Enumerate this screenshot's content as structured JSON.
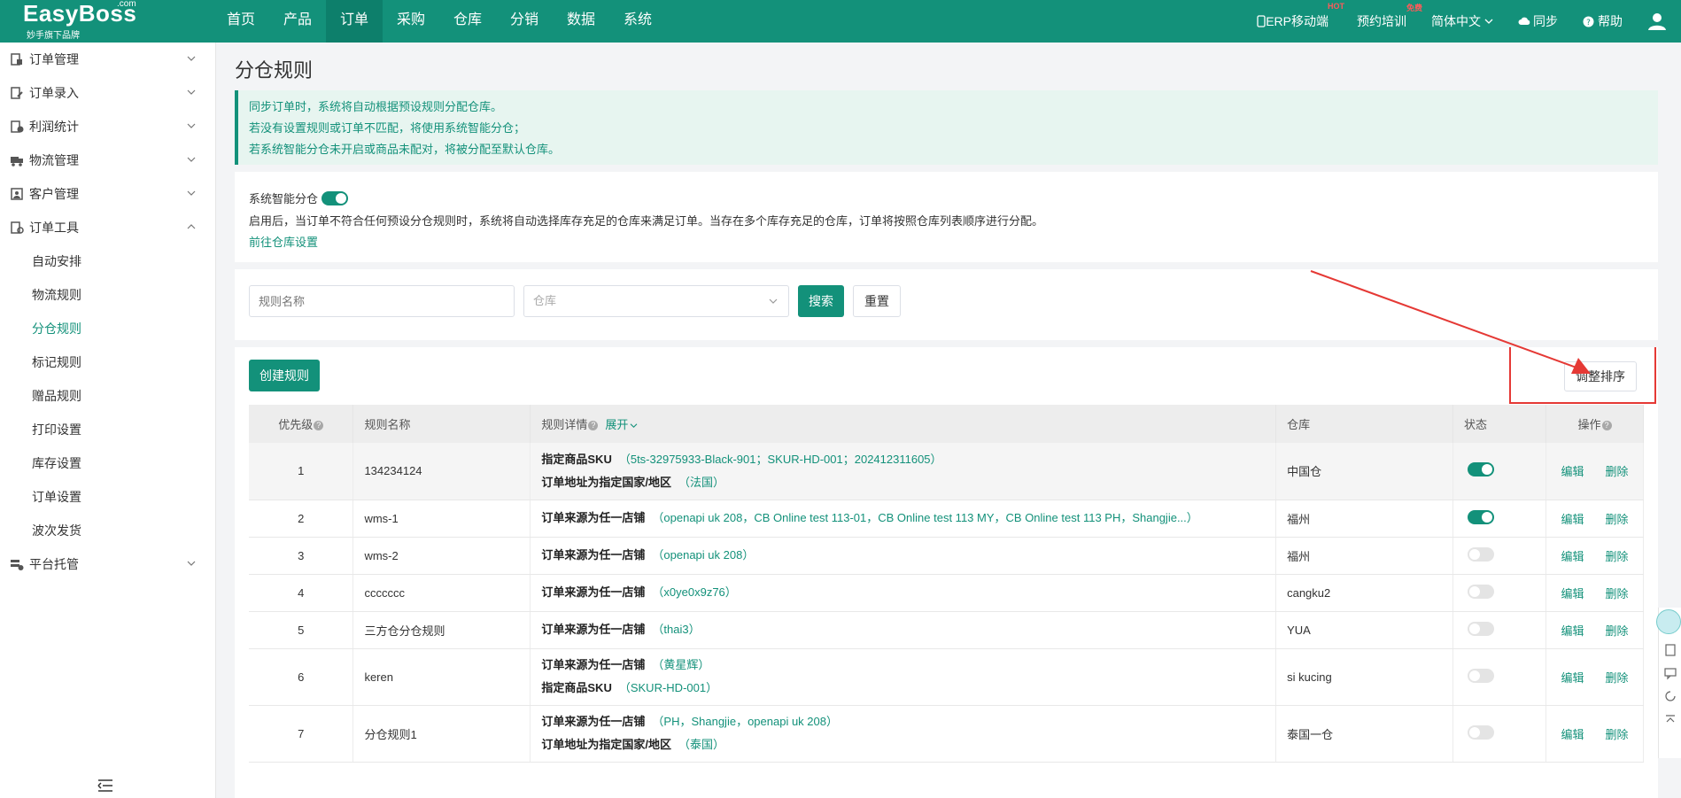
{
  "logo": {
    "name": "EasyBoss",
    "com": ".com",
    "sub": "妙手旗下品牌"
  },
  "nav": [
    {
      "label": "首页"
    },
    {
      "label": "产品"
    },
    {
      "label": "订单",
      "active": true
    },
    {
      "label": "采购"
    },
    {
      "label": "仓库"
    },
    {
      "label": "分销"
    },
    {
      "label": "数据"
    },
    {
      "label": "系统"
    }
  ],
  "topRight": {
    "erp": "ERP移动端",
    "erp_badge": "HOT",
    "training": "预约培训",
    "training_badge": "免费",
    "language": "简体中文",
    "sync": "同步",
    "help": "帮助"
  },
  "sidebar": {
    "groups": [
      {
        "label": "订单管理",
        "icon": "order-manage-icon"
      },
      {
        "label": "订单录入",
        "icon": "order-entry-icon"
      },
      {
        "label": "利润统计",
        "icon": "profit-icon"
      },
      {
        "label": "物流管理",
        "icon": "truck-icon"
      },
      {
        "label": "客户管理",
        "icon": "customer-icon"
      },
      {
        "label": "订单工具",
        "icon": "tools-icon",
        "expanded": true
      }
    ],
    "subItems": [
      "自动安排",
      "物流规则",
      "分仓规则",
      "标记规则",
      "赠品规则",
      "打印设置",
      "库存设置",
      "订单设置",
      "波次发货"
    ],
    "activeSub": "分仓规则",
    "lastGroup": {
      "label": "平台托管",
      "icon": "platform-icon"
    }
  },
  "page": {
    "title": "分仓规则",
    "notice": [
      "同步订单时，系统将自动根据预设规则分配仓库。",
      "若没有设置规则或订单不匹配，将使用系统智能分仓；",
      "若系统智能分仓未开启或商品未配对，将被分配至默认仓库。"
    ],
    "smart": {
      "label": "系统智能分仓",
      "enabled": true,
      "desc": "启用后，当订单不符合任何预设分仓规则时，系统将自动选择库存充足的仓库来满足订单。当存在多个库存充足的仓库，订单将按照仓库列表顺序进行分配。",
      "link": "前往仓库设置"
    },
    "filters": {
      "name_placeholder": "规则名称",
      "warehouse_placeholder": "仓库",
      "search": "搜索",
      "reset": "重置"
    },
    "create": "创建规则",
    "sort": "调整排序"
  },
  "table": {
    "headers": {
      "priority": "优先级",
      "name": "规则名称",
      "detail": "规则详情",
      "expand": "展开",
      "warehouse": "仓库",
      "status": "状态",
      "action": "操作"
    },
    "edit": "编辑",
    "delete": "删除",
    "rows": [
      {
        "priority": "1",
        "name": "134234124",
        "lines": [
          {
            "label": "指定商品SKU",
            "value": "（5ts-32975933-Black-901；SKUR-HD-001；202412311605）"
          },
          {
            "label": "订单地址为指定国家/地区",
            "value": "（法国）"
          }
        ],
        "warehouse": "中国仓",
        "status": true
      },
      {
        "priority": "2",
        "name": "wms-1",
        "lines": [
          {
            "label": "订单来源为任一店铺",
            "value": "（openapi uk 208，CB Online test 113-01，CB Online test 113 MY，CB Online test 113 PH，Shangjie...）"
          }
        ],
        "warehouse": "福州",
        "status": true
      },
      {
        "priority": "3",
        "name": "wms-2",
        "lines": [
          {
            "label": "订单来源为任一店铺",
            "value": "（openapi uk 208）"
          }
        ],
        "warehouse": "福州",
        "status": false
      },
      {
        "priority": "4",
        "name": "ccccccc",
        "lines": [
          {
            "label": "订单来源为任一店铺",
            "value": "（x0ye0x9z76）"
          }
        ],
        "warehouse": "cangku2",
        "status": false
      },
      {
        "priority": "5",
        "name": "三方仓分仓规则",
        "lines": [
          {
            "label": "订单来源为任一店铺",
            "value": "（thai3）"
          }
        ],
        "warehouse": "YUA",
        "status": false
      },
      {
        "priority": "6",
        "name": "keren",
        "lines": [
          {
            "label": "订单来源为任一店铺",
            "value": "（黄星辉）"
          },
          {
            "label": "指定商品SKU",
            "value": "（SKUR-HD-001）"
          }
        ],
        "warehouse": "si kucing",
        "status": false
      },
      {
        "priority": "7",
        "name": "分仓规则1",
        "lines": [
          {
            "label": "订单来源为任一店铺",
            "value": "（PH，Shangjie，openapi uk 208）"
          },
          {
            "label": "订单地址为指定国家/地区",
            "value": "（泰国）"
          }
        ],
        "warehouse": "泰国一仓",
        "status": false
      }
    ]
  },
  "colors": {
    "brand": "#13917a",
    "annotation": "#e53935"
  }
}
